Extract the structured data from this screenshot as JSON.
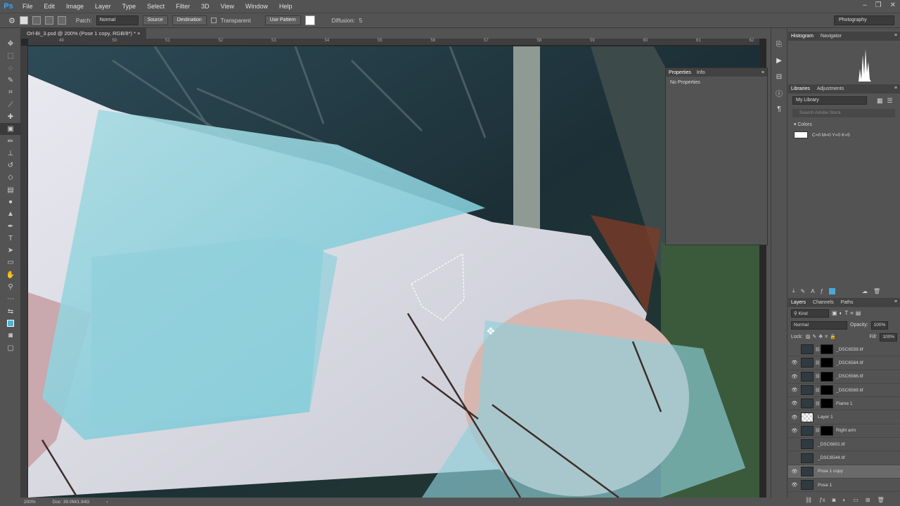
{
  "app": {
    "logo": "Ps"
  },
  "menu": [
    "File",
    "Edit",
    "Image",
    "Layer",
    "Type",
    "Select",
    "Filter",
    "3D",
    "View",
    "Window",
    "Help"
  ],
  "window_controls": [
    "–",
    "❐",
    "✕"
  ],
  "options": {
    "patch_label": "Patch:",
    "patch_mode": "Normal",
    "source": "Source",
    "destination": "Destination",
    "transparent": "Transparent",
    "use_pattern": "Use Pattern",
    "diffusion_label": "Diffusion:",
    "diffusion_value": "5"
  },
  "workspace": "Photography",
  "doc_tab": "Orl-Bi_3.psd @ 200% (Pose 1 copy, RGB/8*) *",
  "ruler": [
    "49",
    "50",
    "51",
    "52",
    "53",
    "54",
    "55",
    "56",
    "57",
    "58",
    "59",
    "60",
    "61",
    "62"
  ],
  "properties": {
    "tab_active": "Properties",
    "tab_other": "Info",
    "body": "No Properties"
  },
  "histogram": {
    "tab_active": "Histogram",
    "tab_other": "Navigator"
  },
  "libraries": {
    "tab_active": "Libraries",
    "tab_other": "Adjustments",
    "selected": "My Library",
    "search_placeholder": "Search Adobe Stock",
    "colors_header": "Colors",
    "color_label": "C=0 M=0 Y=0 K=5"
  },
  "layers_panel": {
    "tab_active": "Layers",
    "tab_channels": "Channels",
    "tab_paths": "Paths",
    "filter": "Kind",
    "blend": "Normal",
    "opacity_label": "Opacity:",
    "opacity": "100%",
    "lock_label": "Lock:",
    "fill_label": "Fill:",
    "fill": "100%",
    "layers": [
      {
        "name": "_DSC6559.tif",
        "visible": false,
        "mask": true
      },
      {
        "name": "_DSC6564.tif",
        "visible": true,
        "mask": true
      },
      {
        "name": "_DSC6566.tif",
        "visible": true,
        "mask": true
      },
      {
        "name": "_DSC6569.tif",
        "visible": true,
        "mask": true
      },
      {
        "name": "Flame 1",
        "visible": true,
        "mask": true
      },
      {
        "name": "Layer 1",
        "visible": true,
        "mask": false
      },
      {
        "name": "Right arm",
        "visible": true,
        "mask": true
      },
      {
        "name": "_DSC6601.tif",
        "visible": false,
        "mask": false
      },
      {
        "name": "_DSC6544.tif",
        "visible": false,
        "mask": false
      },
      {
        "name": "Pose 1 copy",
        "visible": true,
        "mask": false,
        "selected": true
      },
      {
        "name": "Pose 1",
        "visible": true,
        "mask": false
      }
    ]
  },
  "status": {
    "zoom": "200%",
    "doc": "Doc: 39.0M/1.94G"
  }
}
